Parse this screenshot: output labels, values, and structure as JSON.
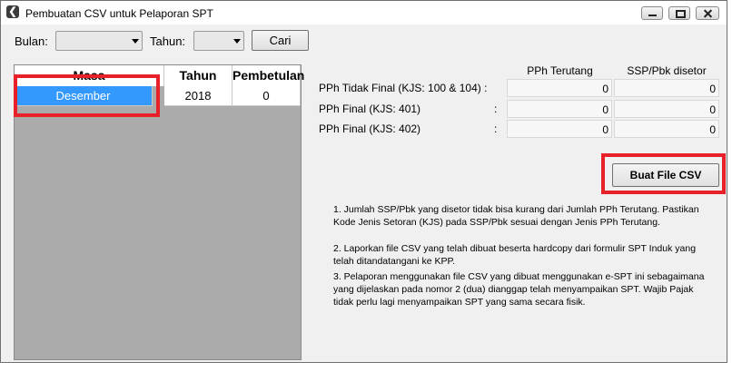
{
  "window": {
    "title": "Pembuatan CSV untuk Pelaporan SPT",
    "app_icon": "app-logo-icon",
    "controls": [
      "minimize-icon",
      "maximize-icon",
      "close-icon"
    ]
  },
  "filters": {
    "bulan_label": "Bulan:",
    "bulan_value": "",
    "tahun_label": "Tahun:",
    "tahun_value": "",
    "cari_label": "Cari"
  },
  "grid": {
    "headers": [
      "Masa",
      "Tahun",
      "Pembetulan"
    ],
    "rows": [
      {
        "masa": "Desember",
        "tahun": "2018",
        "pembetulan": "0"
      }
    ]
  },
  "summary": {
    "col_terutang": "PPh Terutang",
    "col_disetor": "SSP/Pbk disetor",
    "rows": [
      {
        "label": "PPh Tidak Final (KJS: 100 & 104) :",
        "colon": "",
        "terutang": "0",
        "disetor": "0"
      },
      {
        "label": "PPh Final (KJS: 401)",
        "colon": ":",
        "terutang": "0",
        "disetor": "0"
      },
      {
        "label": "PPh Final (KJS: 402)",
        "colon": ":",
        "terutang": "0",
        "disetor": "0"
      }
    ]
  },
  "actions": {
    "buat_csv_label": "Buat File CSV"
  },
  "notes": [
    "1. Jumlah SSP/Pbk yang disetor tidak bisa kurang dari Jumlah PPh Terutang. Pastikan Kode Jenis Setoran (KJS) pada SSP/Pbk sesuai dengan Jenis PPh Terutang.",
    "2. Laporkan file CSV yang telah dibuat beserta hardcopy dari formulir SPT Induk yang telah ditandatangani ke KPP.",
    "3. Pelaporan menggunakan file CSV yang dibuat menggunakan e-SPT ini sebagaimana yang dijelaskan pada nomor 2 (dua) dianggap telah menyampaikan SPT. Wajib Pajak tidak perlu lagi menyampaikan SPT yang sama secara fisik."
  ],
  "colors": {
    "selected_row": "#3399ff",
    "highlight": "#e8202a",
    "grid_bg": "#ababab"
  }
}
